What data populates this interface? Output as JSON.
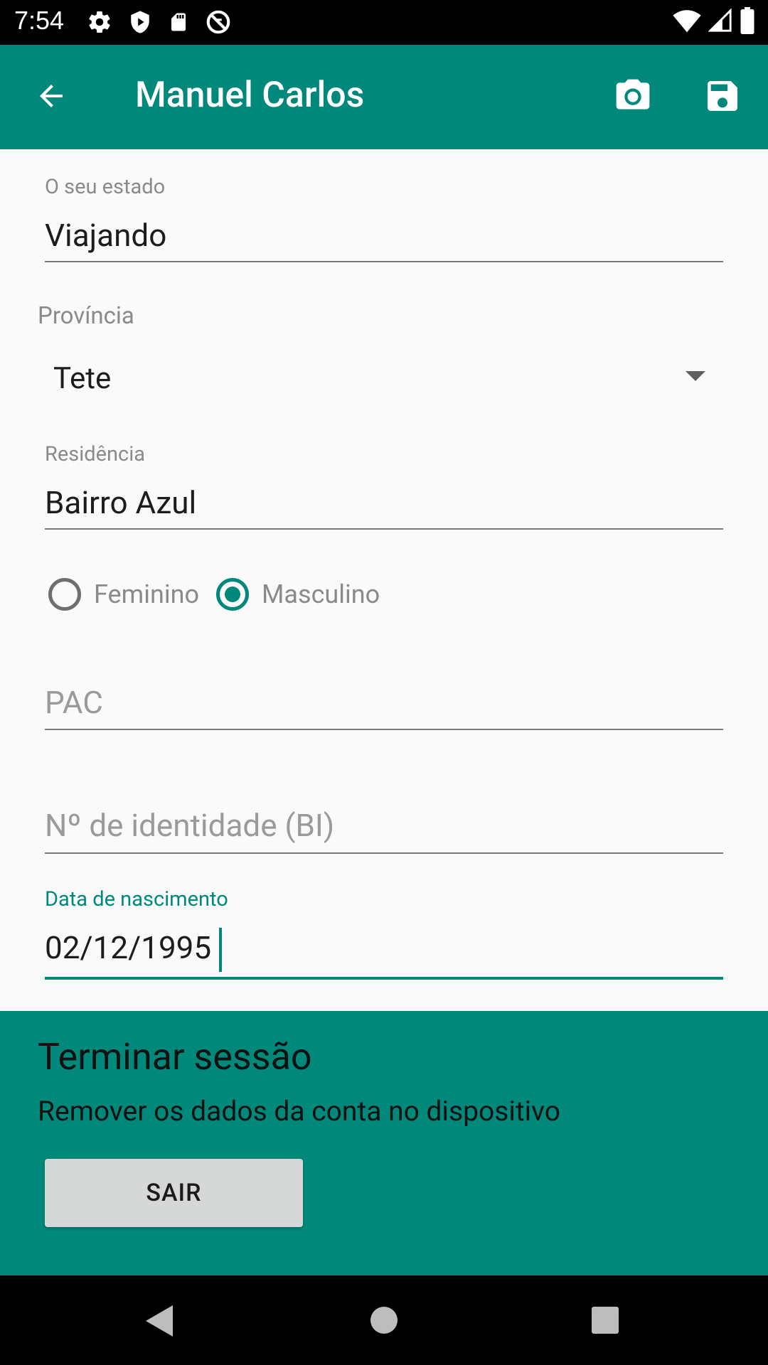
{
  "status_bar": {
    "time": "7:54",
    "left_icons": [
      "gear-icon",
      "play-protect-icon",
      "sd-card-icon",
      "no-sync-icon"
    ],
    "right_icons": [
      "wifi-icon",
      "cell-signal-icon",
      "battery-icon"
    ]
  },
  "app_bar": {
    "title": "Manuel Carlos",
    "back_icon": "arrow-back-icon",
    "camera_icon": "camera-icon",
    "save_icon": "save-icon",
    "background_color": "#00897B"
  },
  "form": {
    "status": {
      "label": "O seu estado",
      "value": "Viajando"
    },
    "province": {
      "label": "Província",
      "selected": "Tete"
    },
    "residence": {
      "label": "Residência",
      "value": "Bairro Azul"
    },
    "gender": {
      "options": [
        {
          "label": "Feminino",
          "checked": false
        },
        {
          "label": "Masculino",
          "checked": true
        }
      ]
    },
    "pac": {
      "placeholder": "PAC",
      "value": ""
    },
    "id_number": {
      "placeholder": "Nº de identidade (BI)",
      "value": ""
    },
    "birth_date": {
      "label": "Data de nascimento",
      "value": "02/12/1995"
    }
  },
  "logout": {
    "title": "Terminar sessão",
    "description": "Remover os dados da conta no dispositivo",
    "button_label": "SAIR"
  },
  "nav_bar": {
    "icons": [
      "nav-back-icon",
      "nav-home-icon",
      "nav-recents-icon"
    ]
  },
  "colors": {
    "accent": "#00897B",
    "background": "#FAFAFA",
    "button": "#D6D7D7"
  }
}
